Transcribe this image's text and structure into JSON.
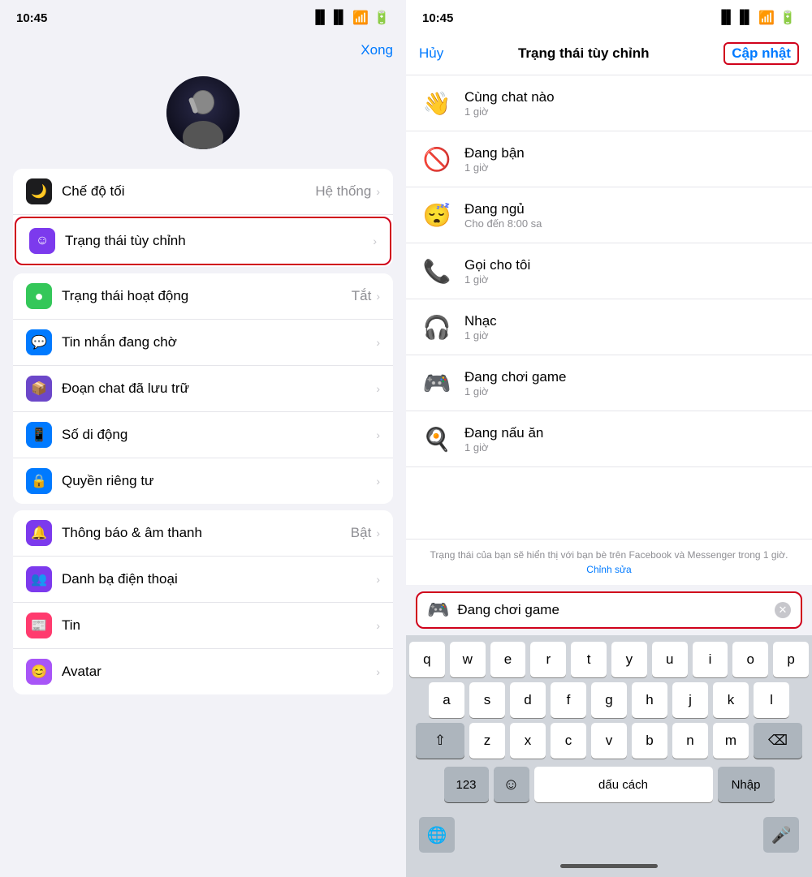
{
  "left": {
    "statusBar": {
      "time": "10:45"
    },
    "header": {
      "xong": "Xong"
    },
    "groups": [
      {
        "id": "group1",
        "items": [
          {
            "id": "che-do-toi",
            "label": "Chế độ tối",
            "value": "Hệ thống",
            "icon": "moon",
            "iconBg": "dark",
            "highlighted": false
          },
          {
            "id": "trang-thai-tuy-chinh",
            "label": "Trạng thái tùy chỉnh",
            "value": "",
            "icon": "smile",
            "iconBg": "purple",
            "highlighted": true
          }
        ]
      },
      {
        "id": "group2",
        "items": [
          {
            "id": "trang-thai-hoat-dong",
            "label": "Trạng thái hoạt động",
            "value": "Tắt",
            "icon": "dot",
            "iconBg": "green",
            "highlighted": false
          },
          {
            "id": "tin-nhan-dang-cho",
            "label": "Tin nhắn đang chờ",
            "value": "",
            "icon": "bubble",
            "iconBg": "blue-msg",
            "highlighted": false
          },
          {
            "id": "doan-chat",
            "label": "Đoạn chat đã lưu trữ",
            "value": "",
            "icon": "archive",
            "iconBg": "purple-archive",
            "highlighted": false
          },
          {
            "id": "so-di-dong",
            "label": "Số di động",
            "value": "",
            "icon": "phone",
            "iconBg": "blue-phone",
            "highlighted": false
          },
          {
            "id": "quyen-rieng-tu",
            "label": "Quyền riêng tư",
            "value": "",
            "icon": "lock",
            "iconBg": "blue-privacy",
            "highlighted": false
          }
        ]
      },
      {
        "id": "group3",
        "items": [
          {
            "id": "thong-bao",
            "label": "Thông báo & âm thanh",
            "value": "Bật",
            "icon": "bell",
            "iconBg": "purple-notif",
            "highlighted": false
          },
          {
            "id": "danh-ba",
            "label": "Danh bạ điện thoại",
            "value": "",
            "icon": "people",
            "iconBg": "purple-contacts",
            "highlighted": false
          },
          {
            "id": "tin",
            "label": "Tin",
            "value": "",
            "icon": "newspaper",
            "iconBg": "pink",
            "highlighted": false
          },
          {
            "id": "avatar",
            "label": "Avatar",
            "value": "",
            "icon": "avatar",
            "iconBg": "purple-avatar",
            "highlighted": false
          }
        ]
      }
    ]
  },
  "right": {
    "statusBar": {
      "time": "10:45"
    },
    "nav": {
      "huy": "Hủy",
      "title": "Trạng thái tùy chỉnh",
      "capNhat": "Cập nhật"
    },
    "statusList": [
      {
        "id": "cung-chat",
        "emoji": "👋",
        "name": "Cùng chat nào",
        "sub": "1 giờ"
      },
      {
        "id": "dang-ban",
        "emoji": "🚫",
        "name": "Đang bận",
        "sub": "1 giờ"
      },
      {
        "id": "dang-ngu",
        "emoji": "😴",
        "name": "Đang ngủ",
        "sub": "Cho đến 8:00 sa"
      },
      {
        "id": "goi-cho-toi",
        "emoji": "📞",
        "name": "Gọi cho tôi",
        "sub": "1 giờ"
      },
      {
        "id": "nhac",
        "emoji": "🎧",
        "name": "Nhạc",
        "sub": "1 giờ"
      },
      {
        "id": "dang-choi-game",
        "emoji": "🎮",
        "name": "Đang chơi game",
        "sub": "1 giờ"
      },
      {
        "id": "dang-nau-an",
        "emoji": "🍳",
        "name": "Đang nấu ăn",
        "sub": "1 giờ"
      }
    ],
    "note": {
      "text": "Trạng thái của bạn sẽ hiển thị với bạn bè trên Facebook và Messenger trong 1 giờ.",
      "linkText": "Chỉnh sửa"
    },
    "inputBar": {
      "icon": "🎮",
      "value": "Đang chơi game",
      "placeholder": "Đang chơi game"
    },
    "keyboard": {
      "rows": [
        [
          "q",
          "w",
          "e",
          "r",
          "t",
          "y",
          "u",
          "i",
          "o",
          "p"
        ],
        [
          "a",
          "s",
          "d",
          "f",
          "g",
          "h",
          "j",
          "k",
          "l"
        ],
        [
          "z",
          "x",
          "c",
          "v",
          "b",
          "n",
          "m"
        ]
      ],
      "spaceLabel": "dấu cách",
      "enterLabel": "Nhập",
      "numLabel": "123"
    }
  }
}
